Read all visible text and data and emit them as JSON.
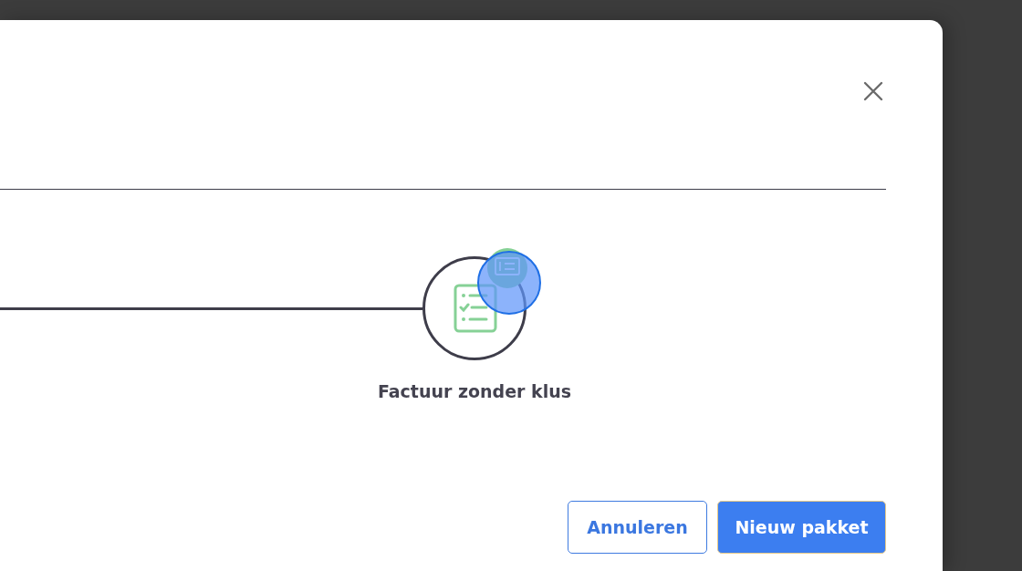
{
  "step": {
    "label": "Factuur zonder klus"
  },
  "buttons": [
    {
      "label": "Annuleren",
      "kind": "secondary"
    },
    {
      "label": "Nieuw pakket",
      "kind": "primary"
    }
  ]
}
